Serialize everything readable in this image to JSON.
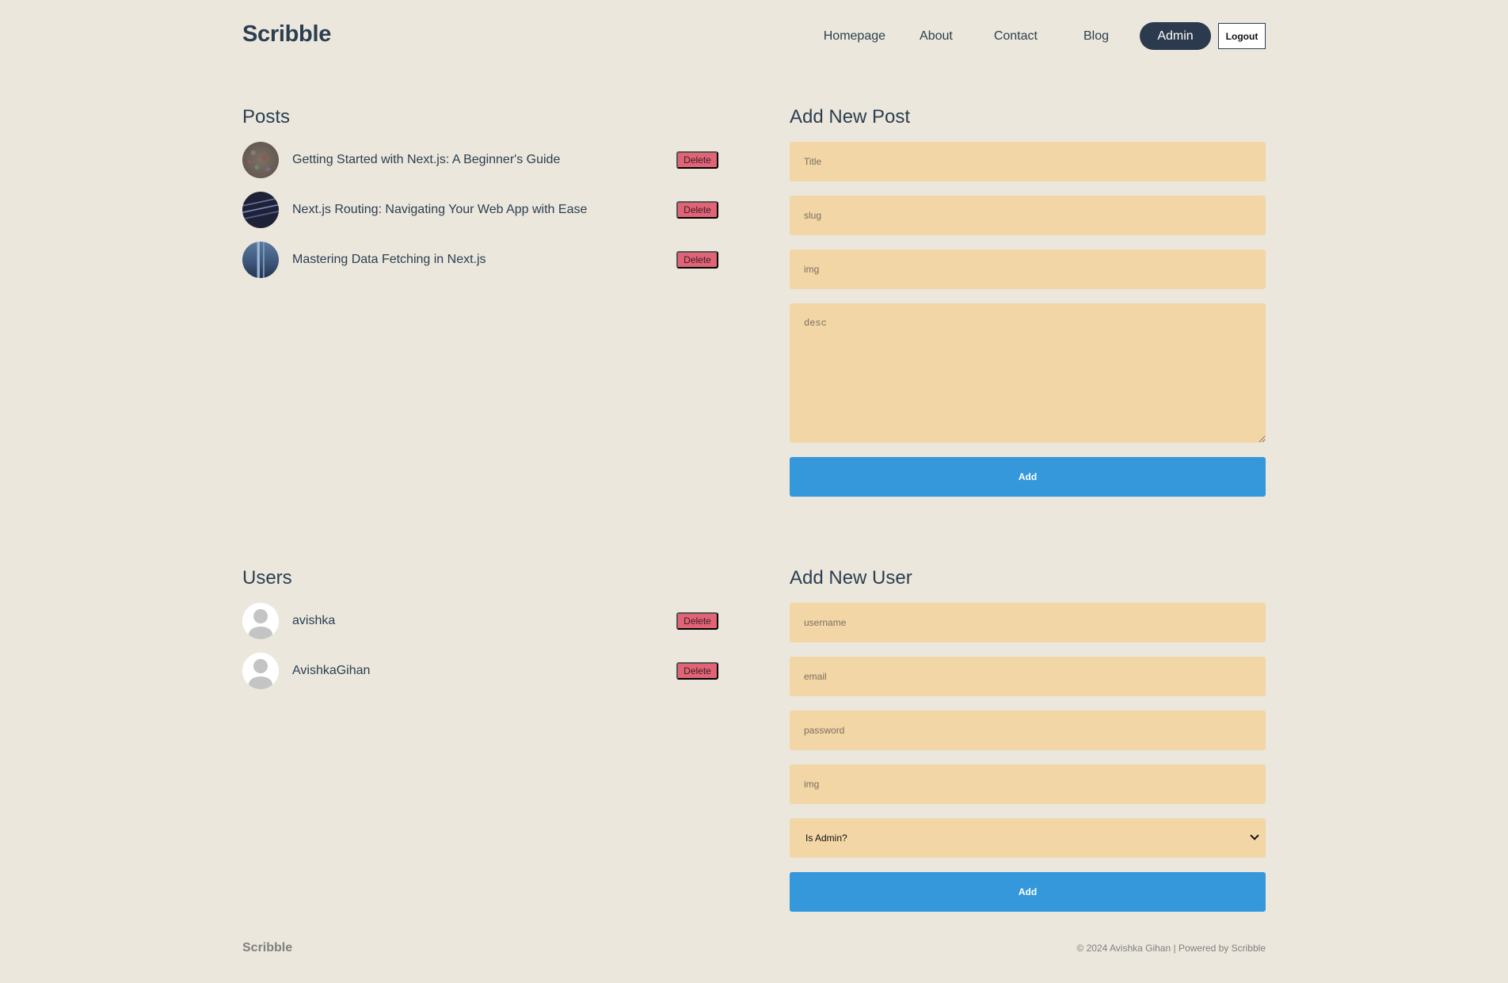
{
  "header": {
    "logo": "Scribble",
    "nav": {
      "homepage": "Homepage",
      "about": "About",
      "contact": "Contact",
      "blog": "Blog",
      "admin": "Admin",
      "logout": "Logout"
    }
  },
  "posts": {
    "title": "Posts",
    "delete_label": "Delete",
    "items": [
      {
        "title": "Getting Started with Next.js: A Beginner's Guide"
      },
      {
        "title": "Next.js Routing: Navigating Your Web App with Ease"
      },
      {
        "title": "Mastering Data Fetching in Next.js"
      }
    ]
  },
  "add_post": {
    "title": "Add New Post",
    "title_placeholder": "Title",
    "slug_placeholder": "slug",
    "img_placeholder": "img",
    "desc_placeholder": "desc",
    "submit": "Add"
  },
  "users": {
    "title": "Users",
    "delete_label": "Delete",
    "items": [
      {
        "username": "avishka"
      },
      {
        "username": "AvishkaGihan"
      }
    ]
  },
  "add_user": {
    "title": "Add New User",
    "username_placeholder": "username",
    "email_placeholder": "email",
    "password_placeholder": "password",
    "img_placeholder": "img",
    "is_admin_selected": "Is Admin?",
    "submit": "Add"
  },
  "footer": {
    "logo": "Scribble",
    "text": "© 2024 Avishka Gihan | Powered by Scribble"
  },
  "colors": {
    "background": "#ebe7dc",
    "text": "#2c3e50",
    "field": "#f2d6a6",
    "button": "#3498db",
    "delete": "#e06476",
    "admin": "#2b3a4c"
  }
}
